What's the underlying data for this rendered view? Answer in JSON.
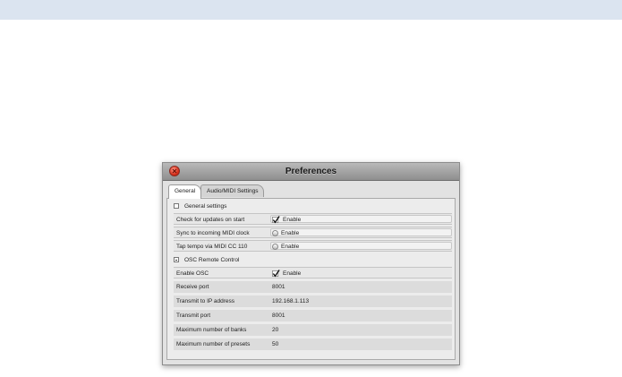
{
  "window": {
    "title": "Preferences",
    "tabs": [
      {
        "label": "General",
        "active": true
      },
      {
        "label": "Audio/MIDI Settings",
        "active": false
      }
    ]
  },
  "general_section": {
    "label": "General settings",
    "rows": [
      {
        "label": "Check for updates on start",
        "control": "checkbox",
        "checked": true,
        "value": "Enable"
      },
      {
        "label": "Sync to incoming MIDI clock",
        "control": "radio",
        "checked": false,
        "value": "Enable"
      },
      {
        "label": "Tap tempo via MIDI CC 110",
        "control": "radio",
        "checked": false,
        "value": "Enable"
      }
    ]
  },
  "osc_section": {
    "label": "OSC Remote Control",
    "rows": [
      {
        "label": "Enable OSC",
        "control": "checkbox",
        "checked": true,
        "value": "Enable"
      },
      {
        "label": "Receive port",
        "value": "8001"
      },
      {
        "label": "Transmit to IP address",
        "value": "192.168.1.113"
      },
      {
        "label": "Transmit port",
        "value": "8001"
      },
      {
        "label": "Maximum number of banks",
        "value": "20"
      },
      {
        "label": "Maximum number of presets",
        "value": "50"
      }
    ]
  },
  "colors": {
    "top_bar": "#dbe4f0",
    "window_bg": "#e2e2e2",
    "close_button": "#d8301c"
  }
}
